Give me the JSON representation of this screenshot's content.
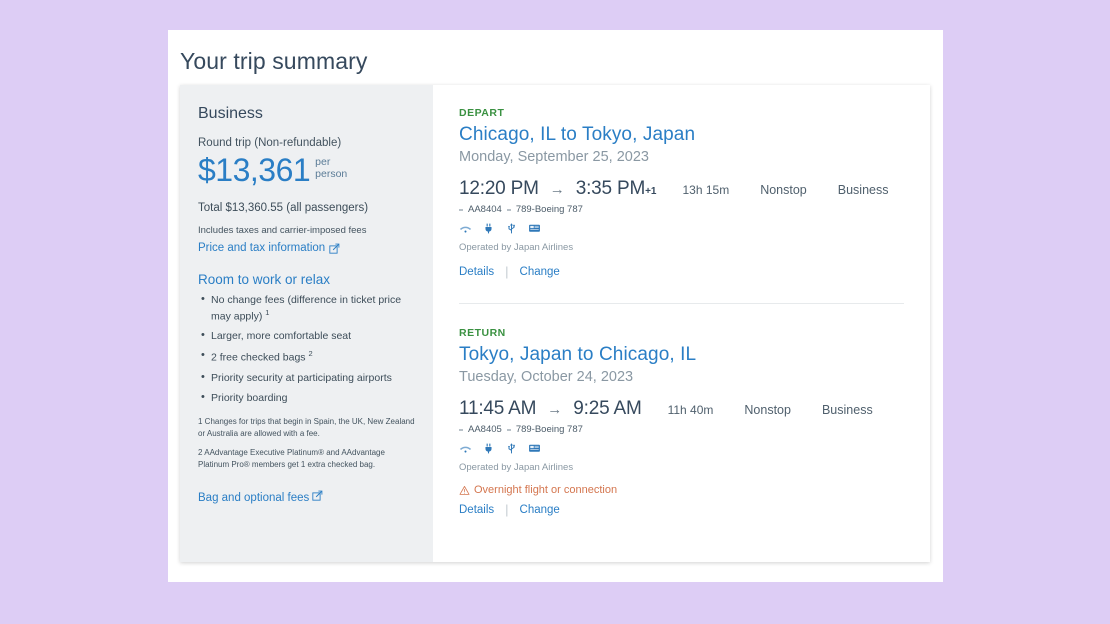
{
  "page": {
    "title": "Your trip summary"
  },
  "sidebar": {
    "cabin": "Business",
    "trip_type": "Round trip (Non-refundable)",
    "price_amount": "$13,361",
    "price_unit_line1": "per",
    "price_unit_line2": "person",
    "total": "Total $13,360.55 (all passengers)",
    "includes": "Includes taxes and carrier-imposed fees",
    "price_tax_link": "Price and tax information",
    "benefits_title": "Room to work or relax",
    "benefits": [
      {
        "text": "No change fees (difference in ticket price may apply)",
        "footnote": "1"
      },
      {
        "text": "Larger, more comfortable seat",
        "footnote": ""
      },
      {
        "text": "2 free checked bags",
        "footnote": "2"
      },
      {
        "text": "Priority security at participating airports",
        "footnote": ""
      },
      {
        "text": "Priority boarding",
        "footnote": ""
      }
    ],
    "footnotes": [
      "1 Changes for trips that begin in Spain, the UK, New Zealand or Australia are allowed with a fee.",
      "2 AAdvantage Executive Platinum® and AAdvantage Platinum Pro® members get 1 extra checked bag."
    ],
    "bag_fees_link": "Bag and optional fees"
  },
  "flights": [
    {
      "leg_label": "DEPART",
      "route": "Chicago, IL to Tokyo, Japan",
      "date": "Monday, September 25, 2023",
      "depart_time": "12:20 PM",
      "arrive_time": "3:35 PM",
      "day_offset": "+1",
      "duration": "13h 15m",
      "stops": "Nonstop",
      "cabin": "Business",
      "flight_number": "AA8404",
      "aircraft": "789-Boeing 787",
      "amenities": [
        "wifi-icon",
        "power-outlet-icon",
        "usb-icon",
        "entertainment-icon"
      ],
      "operated_by": "Operated by Japan Airlines",
      "warning": "",
      "details_label": "Details",
      "change_label": "Change"
    },
    {
      "leg_label": "RETURN",
      "route": "Tokyo, Japan to Chicago, IL",
      "date": "Tuesday, October 24, 2023",
      "depart_time": "11:45 AM",
      "arrive_time": "9:25 AM",
      "day_offset": "",
      "duration": "11h 40m",
      "stops": "Nonstop",
      "cabin": "Business",
      "flight_number": "AA8405",
      "aircraft": "789-Boeing 787",
      "amenities": [
        "wifi-icon",
        "power-outlet-icon",
        "usb-icon",
        "entertainment-icon"
      ],
      "operated_by": "Operated by Japan Airlines",
      "warning": "Overnight flight or connection",
      "details_label": "Details",
      "change_label": "Change"
    }
  ],
  "colors": {
    "background": "#ddcdf5",
    "accent_blue": "#2a7ec5",
    "label_green": "#3a9141",
    "warning_orange": "#d4764f",
    "sidebar_bg": "#eef0f2"
  }
}
